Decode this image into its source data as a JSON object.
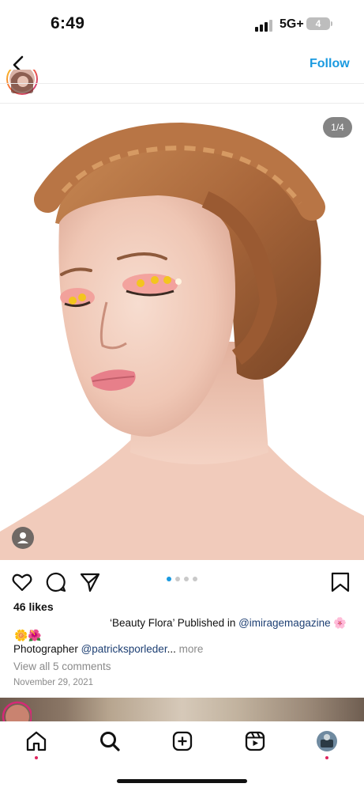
{
  "status_bar": {
    "time": "6:49",
    "network": "5G+",
    "battery": "4"
  },
  "nav": {
    "follow_label": "Follow"
  },
  "post": {
    "image_counter": "1/4",
    "likes": "46 likes",
    "caption": {
      "line1_prefix": "‘Beauty Flora’ Published in ",
      "mention_magazine": "@imiragemagazine",
      "line1_suffix_emoji": "🌸",
      "line2_emoji": "🌼🌺",
      "line3_prefix": "Photographer ",
      "mention_photographer": "@patricksporleder",
      "ellipsis": "...",
      "more_label": " more"
    },
    "view_comments": "View all 5 comments",
    "date": "November 29, 2021",
    "carousel": {
      "total": 4,
      "current": 1
    }
  },
  "colors": {
    "link": "#1a9ae0",
    "mention": "#1d3f73",
    "carousel_active": "#1a9ae0",
    "notification": "#e0245e"
  },
  "icons": {
    "nav": [
      "back-arrow-icon"
    ],
    "actions": [
      "heart-icon",
      "comment-icon",
      "share-icon",
      "bookmark-icon"
    ],
    "tabbar": [
      "home-icon",
      "search-icon",
      "create-icon",
      "reels-icon",
      "profile-avatar"
    ]
  }
}
